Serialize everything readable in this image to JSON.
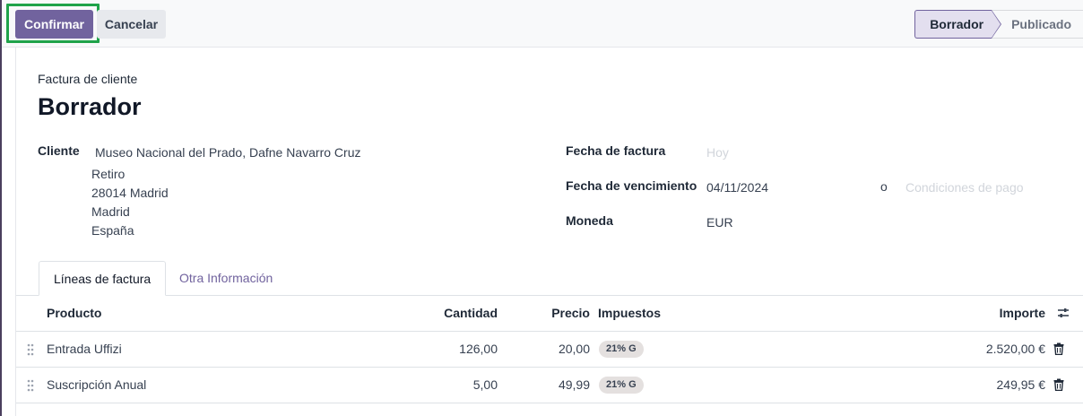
{
  "control_panel": {
    "confirm_label": "Confirmar",
    "cancel_label": "Cancelar",
    "statusbar": {
      "steps": [
        {
          "label": "Borrador",
          "active": true
        },
        {
          "label": "Publicado",
          "active": false
        }
      ]
    }
  },
  "form": {
    "subtitle": "Factura de cliente",
    "title": "Borrador",
    "customer": {
      "label": "Cliente",
      "name": "Museo Nacional del Prado, Dafne Navarro Cruz",
      "address_lines": [
        "Retiro",
        "28014 Madrid",
        "Madrid",
        "España"
      ]
    },
    "invoice_date": {
      "label": "Fecha de factura",
      "placeholder": "Hoy"
    },
    "due_date": {
      "label": "Fecha de vencimiento",
      "value": "04/11/2024",
      "or_text": "o",
      "payment_terms_placeholder": "Condiciones de pago"
    },
    "currency": {
      "label": "Moneda",
      "value": "EUR"
    }
  },
  "tabs": [
    {
      "label": "Líneas de factura",
      "active": true
    },
    {
      "label": "Otra Información",
      "active": false
    }
  ],
  "lines_table": {
    "headers": {
      "product": "Producto",
      "quantity": "Cantidad",
      "price": "Precio",
      "taxes": "Impuestos",
      "amount": "Importe"
    },
    "rows": [
      {
        "product": "Entrada Uffizi",
        "quantity": "126,00",
        "price": "20,00",
        "tax": "21% G",
        "amount": "2.520,00 €"
      },
      {
        "product": "Suscripción Anual",
        "quantity": "5,00",
        "price": "49,99",
        "tax": "21% G",
        "amount": "249,95 €"
      }
    ]
  },
  "icons": {
    "drag_handle": "drag-handle-icon",
    "delete": "trash-icon",
    "optional_columns": "sliders-icon"
  },
  "colors": {
    "primary": "#71639e",
    "focus_ring": "#1fa34a",
    "status_active_bg": "#e3dfef",
    "badge_bg": "#e4e0df"
  }
}
